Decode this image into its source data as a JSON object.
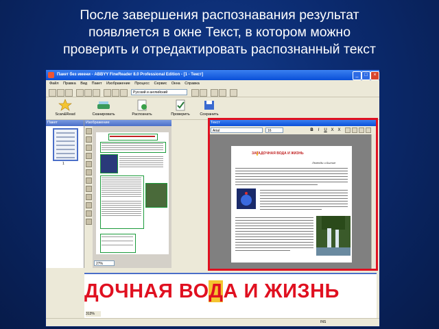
{
  "slide": {
    "title_lines": [
      "После завершения распознавания результат",
      "появляется в окне Текст, в котором можно",
      "проверить и отредактировать распознанный текст"
    ]
  },
  "window": {
    "title": "Пакет без имени - ABBYY FineReader 8.0 Professional Edition - [1 - Текст]",
    "menu": [
      "Файл",
      "Правка",
      "Вид",
      "Пакет",
      "Изображение",
      "Процесс",
      "Сервис",
      "Окна",
      "Справка"
    ],
    "language_select": "Русский и английский",
    "toolbar_buttons": [
      {
        "label": "Scan&Read",
        "icon": "star-wand-icon"
      },
      {
        "label": "Сканировать",
        "icon": "scan-icon"
      },
      {
        "label": "Распознать",
        "icon": "recognize-icon"
      },
      {
        "label": "Проверить",
        "icon": "check-icon"
      },
      {
        "label": "Сохранить",
        "icon": "save-icon"
      }
    ],
    "panels": {
      "batch": "Пакет",
      "image": "Изображение",
      "text": "Текст"
    },
    "batch_page_number": "1",
    "image_zoom": "27%",
    "font_name": "Arial",
    "font_size": "16",
    "format_buttons": [
      "B",
      "I",
      "U",
      "X",
      "X"
    ],
    "text_doc": {
      "title_before": "ЗА",
      "title_highlight": "Г",
      "title_after": "АДОЧНАЯ ВОДА И ЖИЗНЬ",
      "subtitle": "Легенды и Бытие"
    },
    "zoom_text": {
      "before": "ДОЧНАЯ ВО",
      "highlight": "Д",
      "after": "А И ЖИЗНЬ"
    },
    "zoom_percent": "313%",
    "status_ins": "INS"
  }
}
